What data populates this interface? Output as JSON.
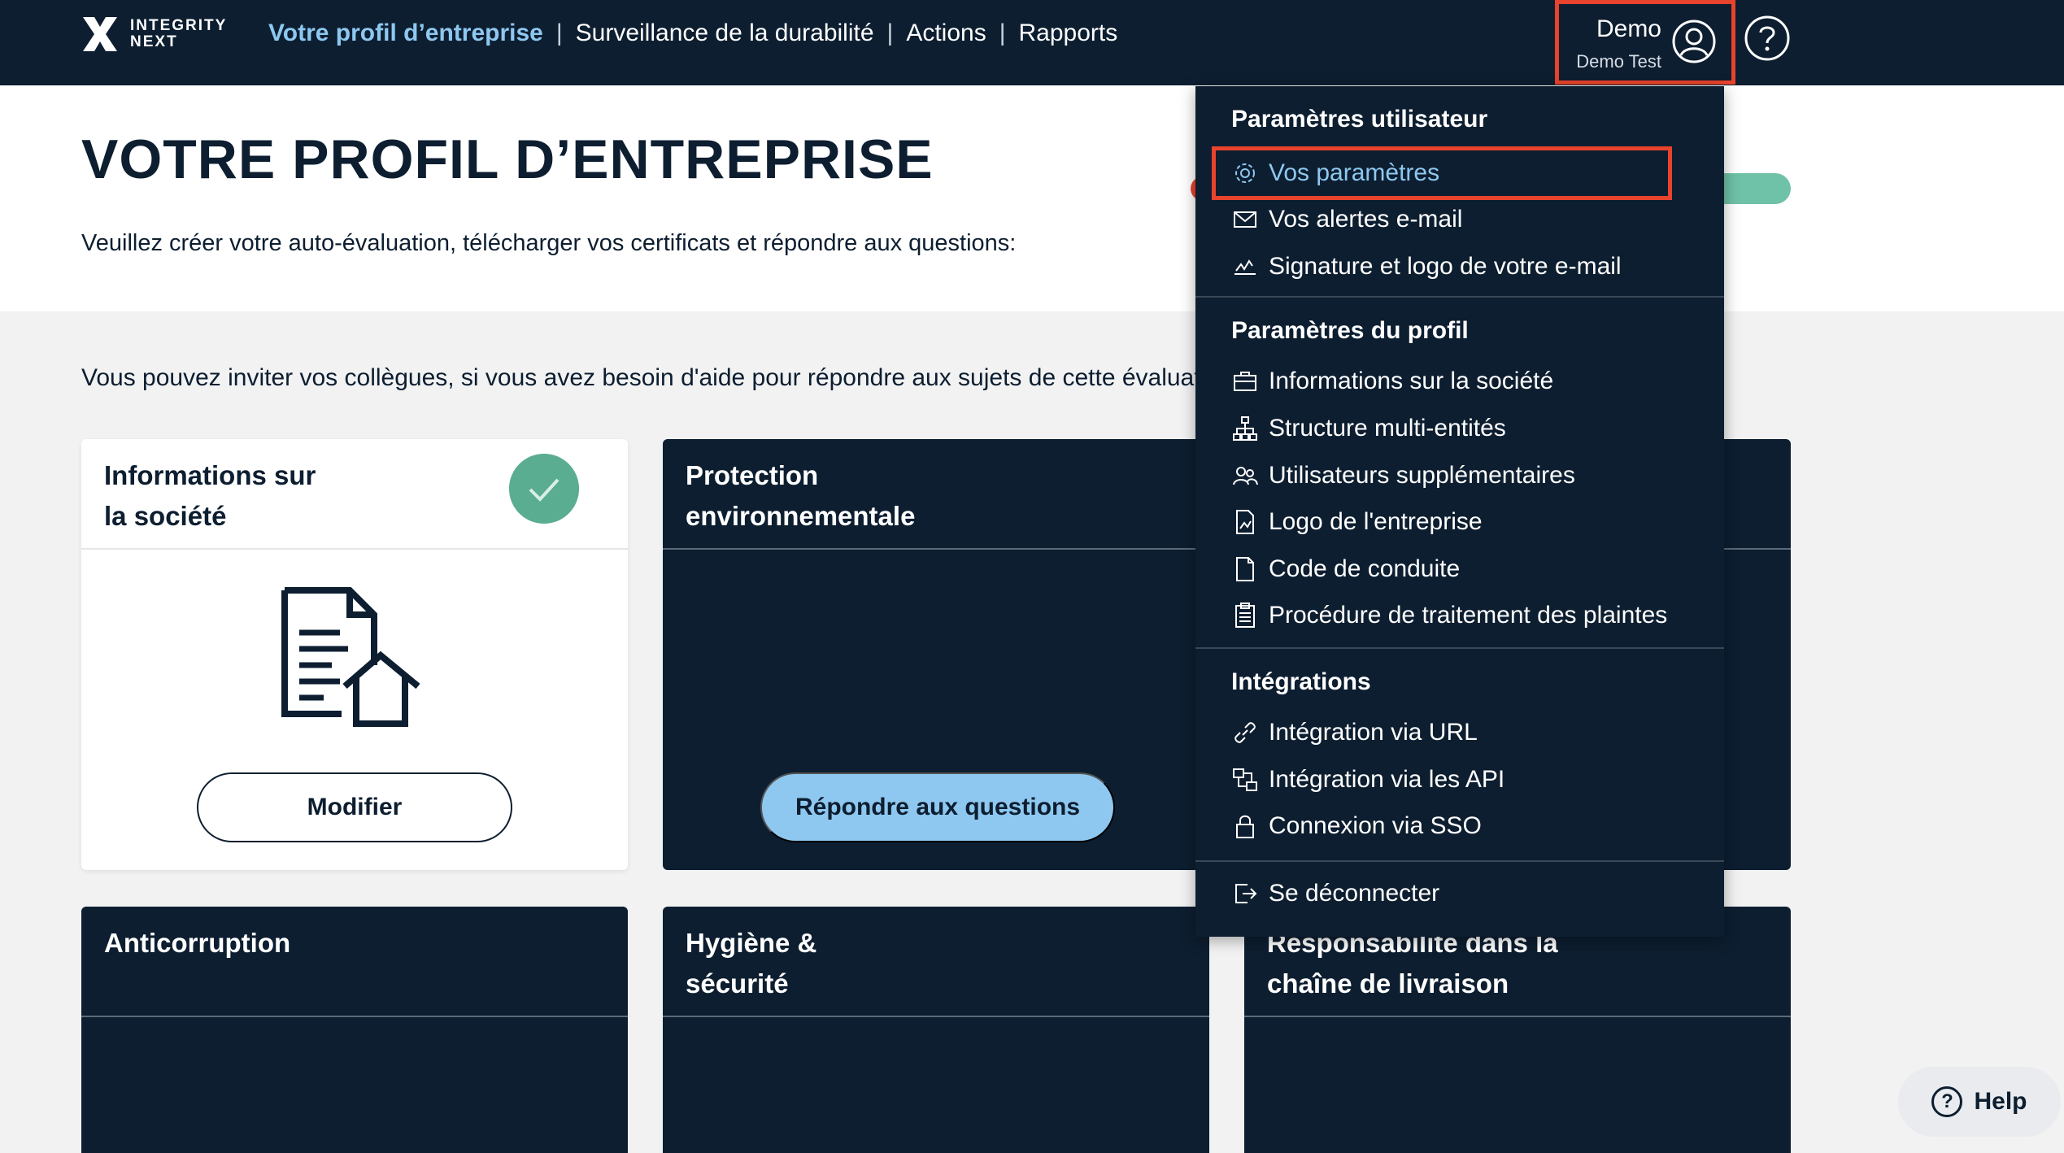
{
  "app": {
    "logo_text_line1": "INTEGRITY",
    "logo_text_line2": "NEXT"
  },
  "nav": {
    "items": [
      {
        "label": "Votre profil d’entreprise",
        "active": true
      },
      {
        "label": "Surveillance de la durabilité",
        "active": false
      },
      {
        "label": "Actions",
        "active": false
      },
      {
        "label": "Rapports",
        "active": false
      }
    ],
    "separator": "|"
  },
  "user": {
    "name": "Demo",
    "subtitle": "Demo Test",
    "icon": "user-circle-icon",
    "help_icon": "question-circle-icon"
  },
  "header": {
    "title": "VOTRE PROFIL D’ENTREPRISE",
    "subtitle": "Veuillez créer votre auto-évaluation, télécharger vos certificats et répondre aux questions:"
  },
  "invite": {
    "text": "Vous pouvez inviter vos collègues, si vous avez besoin d'aide pour répondre aux sujets de cette évaluation"
  },
  "cards": [
    {
      "title_line1": "Informations sur",
      "title_line2": "la société",
      "button": "Modifier",
      "completed": true
    },
    {
      "title_line1": "Protection",
      "title_line2": "environnementale",
      "button": "Répondre aux questions"
    },
    {
      "title_line1": "Anticorruption",
      "title_line2": ""
    },
    {
      "title_line1": "Hygiène &",
      "title_line2": "sécurité"
    },
    {
      "title_line1": "Responsabilité dans la",
      "title_line2": "chaîne de livraison"
    }
  ],
  "menu": {
    "sections": [
      {
        "title": "Paramètres utilisateur",
        "items": [
          {
            "label": "Vos paramètres",
            "icon": "gear-icon",
            "active": true
          },
          {
            "label": "Vos alertes e-mail",
            "icon": "envelope-icon"
          },
          {
            "label": "Signature et logo de votre e-mail",
            "icon": "signature-icon"
          }
        ]
      },
      {
        "title": "Paramètres du profil",
        "items": [
          {
            "label": "Informations sur la société",
            "icon": "briefcase-icon"
          },
          {
            "label": "Structure multi-entités",
            "icon": "hierarchy-icon"
          },
          {
            "label": "Utilisateurs supplémentaires",
            "icon": "users-icon"
          },
          {
            "label": "Logo de l'entreprise",
            "icon": "image-file-icon"
          },
          {
            "label": "Code de conduite",
            "icon": "document-icon"
          },
          {
            "label": "Procédure de traitement des plaintes",
            "icon": "clipboard-icon"
          }
        ]
      },
      {
        "title": "Intégrations",
        "items": [
          {
            "label": "Intégration via URL",
            "icon": "link-icon"
          },
          {
            "label": "Intégration via les API",
            "icon": "api-icon"
          },
          {
            "label": "Connexion via SSO",
            "icon": "lock-icon"
          }
        ]
      }
    ],
    "logout": {
      "label": "Se déconnecter",
      "icon": "logout-icon"
    }
  },
  "help": {
    "label": "Help",
    "icon": "question-icon"
  },
  "colors": {
    "navy": "#0d1e30",
    "accent_blue": "#8ec8f0",
    "success_green": "#5aad90",
    "highlight_red": "#e8432c"
  }
}
